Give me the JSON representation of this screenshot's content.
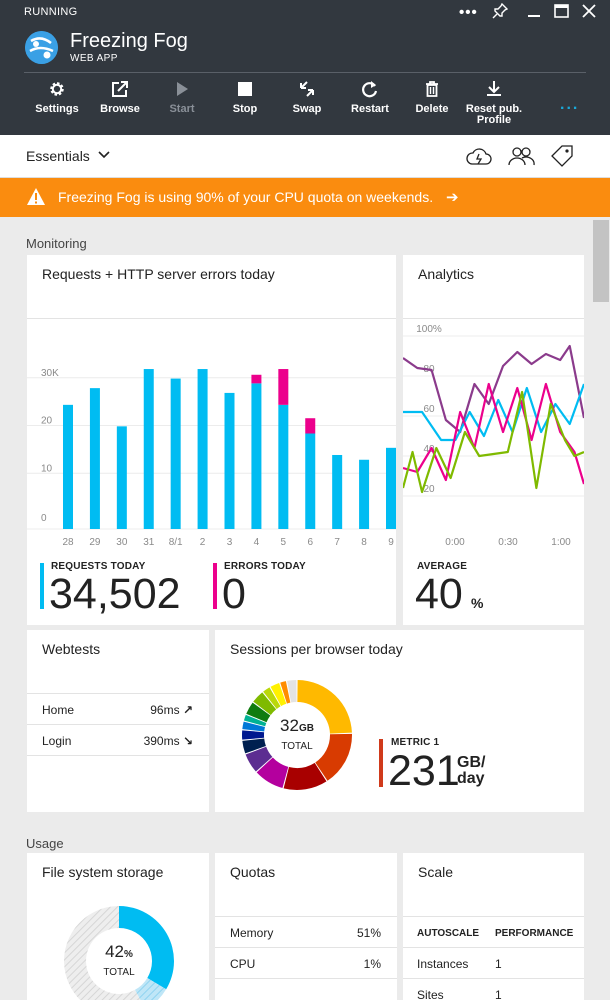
{
  "header": {
    "status": "RUNNING",
    "title": "Freezing Fog",
    "subtitle": "WEB APP",
    "window_controls": [
      "more-icon",
      "pin-icon",
      "minimize-icon",
      "maximize-icon",
      "close-icon"
    ]
  },
  "toolbar": {
    "settings": "Settings",
    "browse": "Browse",
    "start": "Start",
    "stop": "Stop",
    "swap": "Swap",
    "restart": "Restart",
    "delete": "Delete",
    "reset_line1": "Reset pub.",
    "reset_line2": "Profile",
    "more": "..."
  },
  "essentials": {
    "label": "Essentials"
  },
  "warning": {
    "text": "Freezing Fog is using 90% of your CPU quota on weekends.",
    "arrow": "➔"
  },
  "monitoring": {
    "section_label": "Monitoring",
    "requests_tile": {
      "title": "Requests + HTTP server errors today",
      "requests_label": "REQUESTS TODAY",
      "requests_value": "34,502",
      "errors_label": "ERRORS TODAY",
      "errors_value": "0"
    },
    "analytics_tile": {
      "title": "Analytics",
      "average_label": "AVERAGE",
      "average_value": "40",
      "average_unit": "%"
    },
    "webtests_tile": {
      "title": "Webtests",
      "rows": [
        {
          "name": "Home",
          "value": "96ms",
          "arrow": "↗"
        },
        {
          "name": "Login",
          "value": "390ms",
          "arrow": "↘"
        }
      ]
    },
    "sessions_tile": {
      "title": "Sessions per browser today",
      "center_value": "32",
      "center_unit": "GB",
      "center_label": "TOTAL",
      "metric_label": "METRIC 1",
      "metric_value": "231",
      "metric_unit_top": "GB/",
      "metric_unit_bottom": "day"
    }
  },
  "usage": {
    "section_label": "Usage",
    "storage_tile": {
      "title": "File system storage",
      "percent": "42",
      "unit": "%",
      "label": "TOTAL",
      "fraction": 0.42
    },
    "quotas_tile": {
      "title": "Quotas",
      "rows": [
        {
          "name": "Memory",
          "value": "51%"
        },
        {
          "name": "CPU",
          "value": "1%"
        }
      ]
    },
    "scale_tile": {
      "title": "Scale",
      "col1": "AUTOSCALE",
      "col2": "PERFORMANCE",
      "rows": [
        {
          "name": "Instances",
          "value": "1"
        },
        {
          "name": "Sites",
          "value": "1"
        }
      ]
    }
  },
  "colors": {
    "header_bg": "#32383f",
    "accent_blue": "#00bcf2",
    "error_pink": "#ec008c",
    "warning_orange": "#fa8c0f",
    "metric_red": "#d03a1b",
    "line_purple": "#8b3b8c",
    "line_green": "#7fba00"
  },
  "chart_data": [
    {
      "type": "bar",
      "title": "Requests + HTTP server errors today",
      "categories": [
        "28",
        "29",
        "30",
        "31",
        "8/1",
        "2",
        "3",
        "4",
        "5",
        "6",
        "7",
        "8",
        "9"
      ],
      "y_ticks": [
        "0",
        "10",
        "20",
        "30K"
      ],
      "ylim": [
        0,
        40
      ],
      "series": [
        {
          "name": "REQUESTS TODAY",
          "color": "#00bcf2",
          "values": [
            26,
            29.5,
            21.5,
            33.5,
            31.5,
            33.5,
            28.5,
            30.5,
            26,
            20,
            15.5,
            14.5,
            17
          ]
        },
        {
          "name": "ERRORS TODAY",
          "color": "#ec008c",
          "values": [
            0,
            0,
            0,
            0,
            0,
            0,
            0,
            1.8,
            7.5,
            3.2,
            0,
            0,
            0
          ]
        }
      ]
    },
    {
      "type": "line",
      "title": "Analytics",
      "x_ticks": [
        "0:00",
        "0:30",
        "1:00"
      ],
      "y_ticks": [
        "20",
        "40",
        "60",
        "80",
        "100%"
      ],
      "ylim": [
        0,
        100
      ],
      "xlim": [
        0,
        76
      ],
      "series": [
        {
          "color": "#8b3b8c",
          "x": [
            0,
            6,
            12,
            18,
            24,
            30,
            36,
            42,
            48,
            54,
            60,
            66,
            70,
            76
          ],
          "values": [
            85,
            80,
            79,
            54,
            48,
            72,
            62,
            81,
            88,
            82,
            87,
            84,
            91,
            55
          ]
        },
        {
          "color": "#00bcf2",
          "x": [
            0,
            8,
            16,
            22,
            28,
            34,
            40,
            46,
            52,
            58,
            64,
            70,
            76
          ],
          "values": [
            58,
            58,
            44,
            44,
            58,
            46,
            64,
            48,
            70,
            48,
            62,
            52,
            72
          ]
        },
        {
          "color": "#ec008c",
          "x": [
            0,
            6,
            12,
            18,
            24,
            30,
            36,
            42,
            48,
            54,
            60,
            66,
            72,
            76
          ],
          "values": [
            30,
            28,
            40,
            24,
            58,
            40,
            72,
            48,
            70,
            44,
            72,
            48,
            38,
            22
          ]
        },
        {
          "color": "#7fba00",
          "x": [
            0,
            4,
            8,
            14,
            20,
            26,
            32,
            38,
            44,
            50,
            56,
            62,
            68,
            72,
            76
          ],
          "values": [
            20,
            38,
            18,
            40,
            25,
            48,
            36,
            37,
            38,
            68,
            20,
            62,
            44,
            36,
            38
          ]
        }
      ]
    },
    {
      "type": "pie",
      "title": "Sessions per browser today",
      "labels": [
        "",
        "",
        "",
        "",
        "",
        "",
        "",
        "",
        "",
        "",
        "",
        "",
        "",
        "",
        ""
      ],
      "values": [
        24,
        16,
        13,
        9,
        6,
        4,
        3,
        2.5,
        2,
        4,
        4,
        2.5,
        3,
        2,
        3
      ],
      "colors": [
        "#ffb900",
        "#d83b01",
        "#a80000",
        "#b4009e",
        "#5c2d91",
        "#002050",
        "#00188f",
        "#0078d7",
        "#00b294",
        "#107c10",
        "#7fba00",
        "#bad80a",
        "#fff100",
        "#ff8c00",
        "#e3e3e3"
      ]
    }
  ]
}
